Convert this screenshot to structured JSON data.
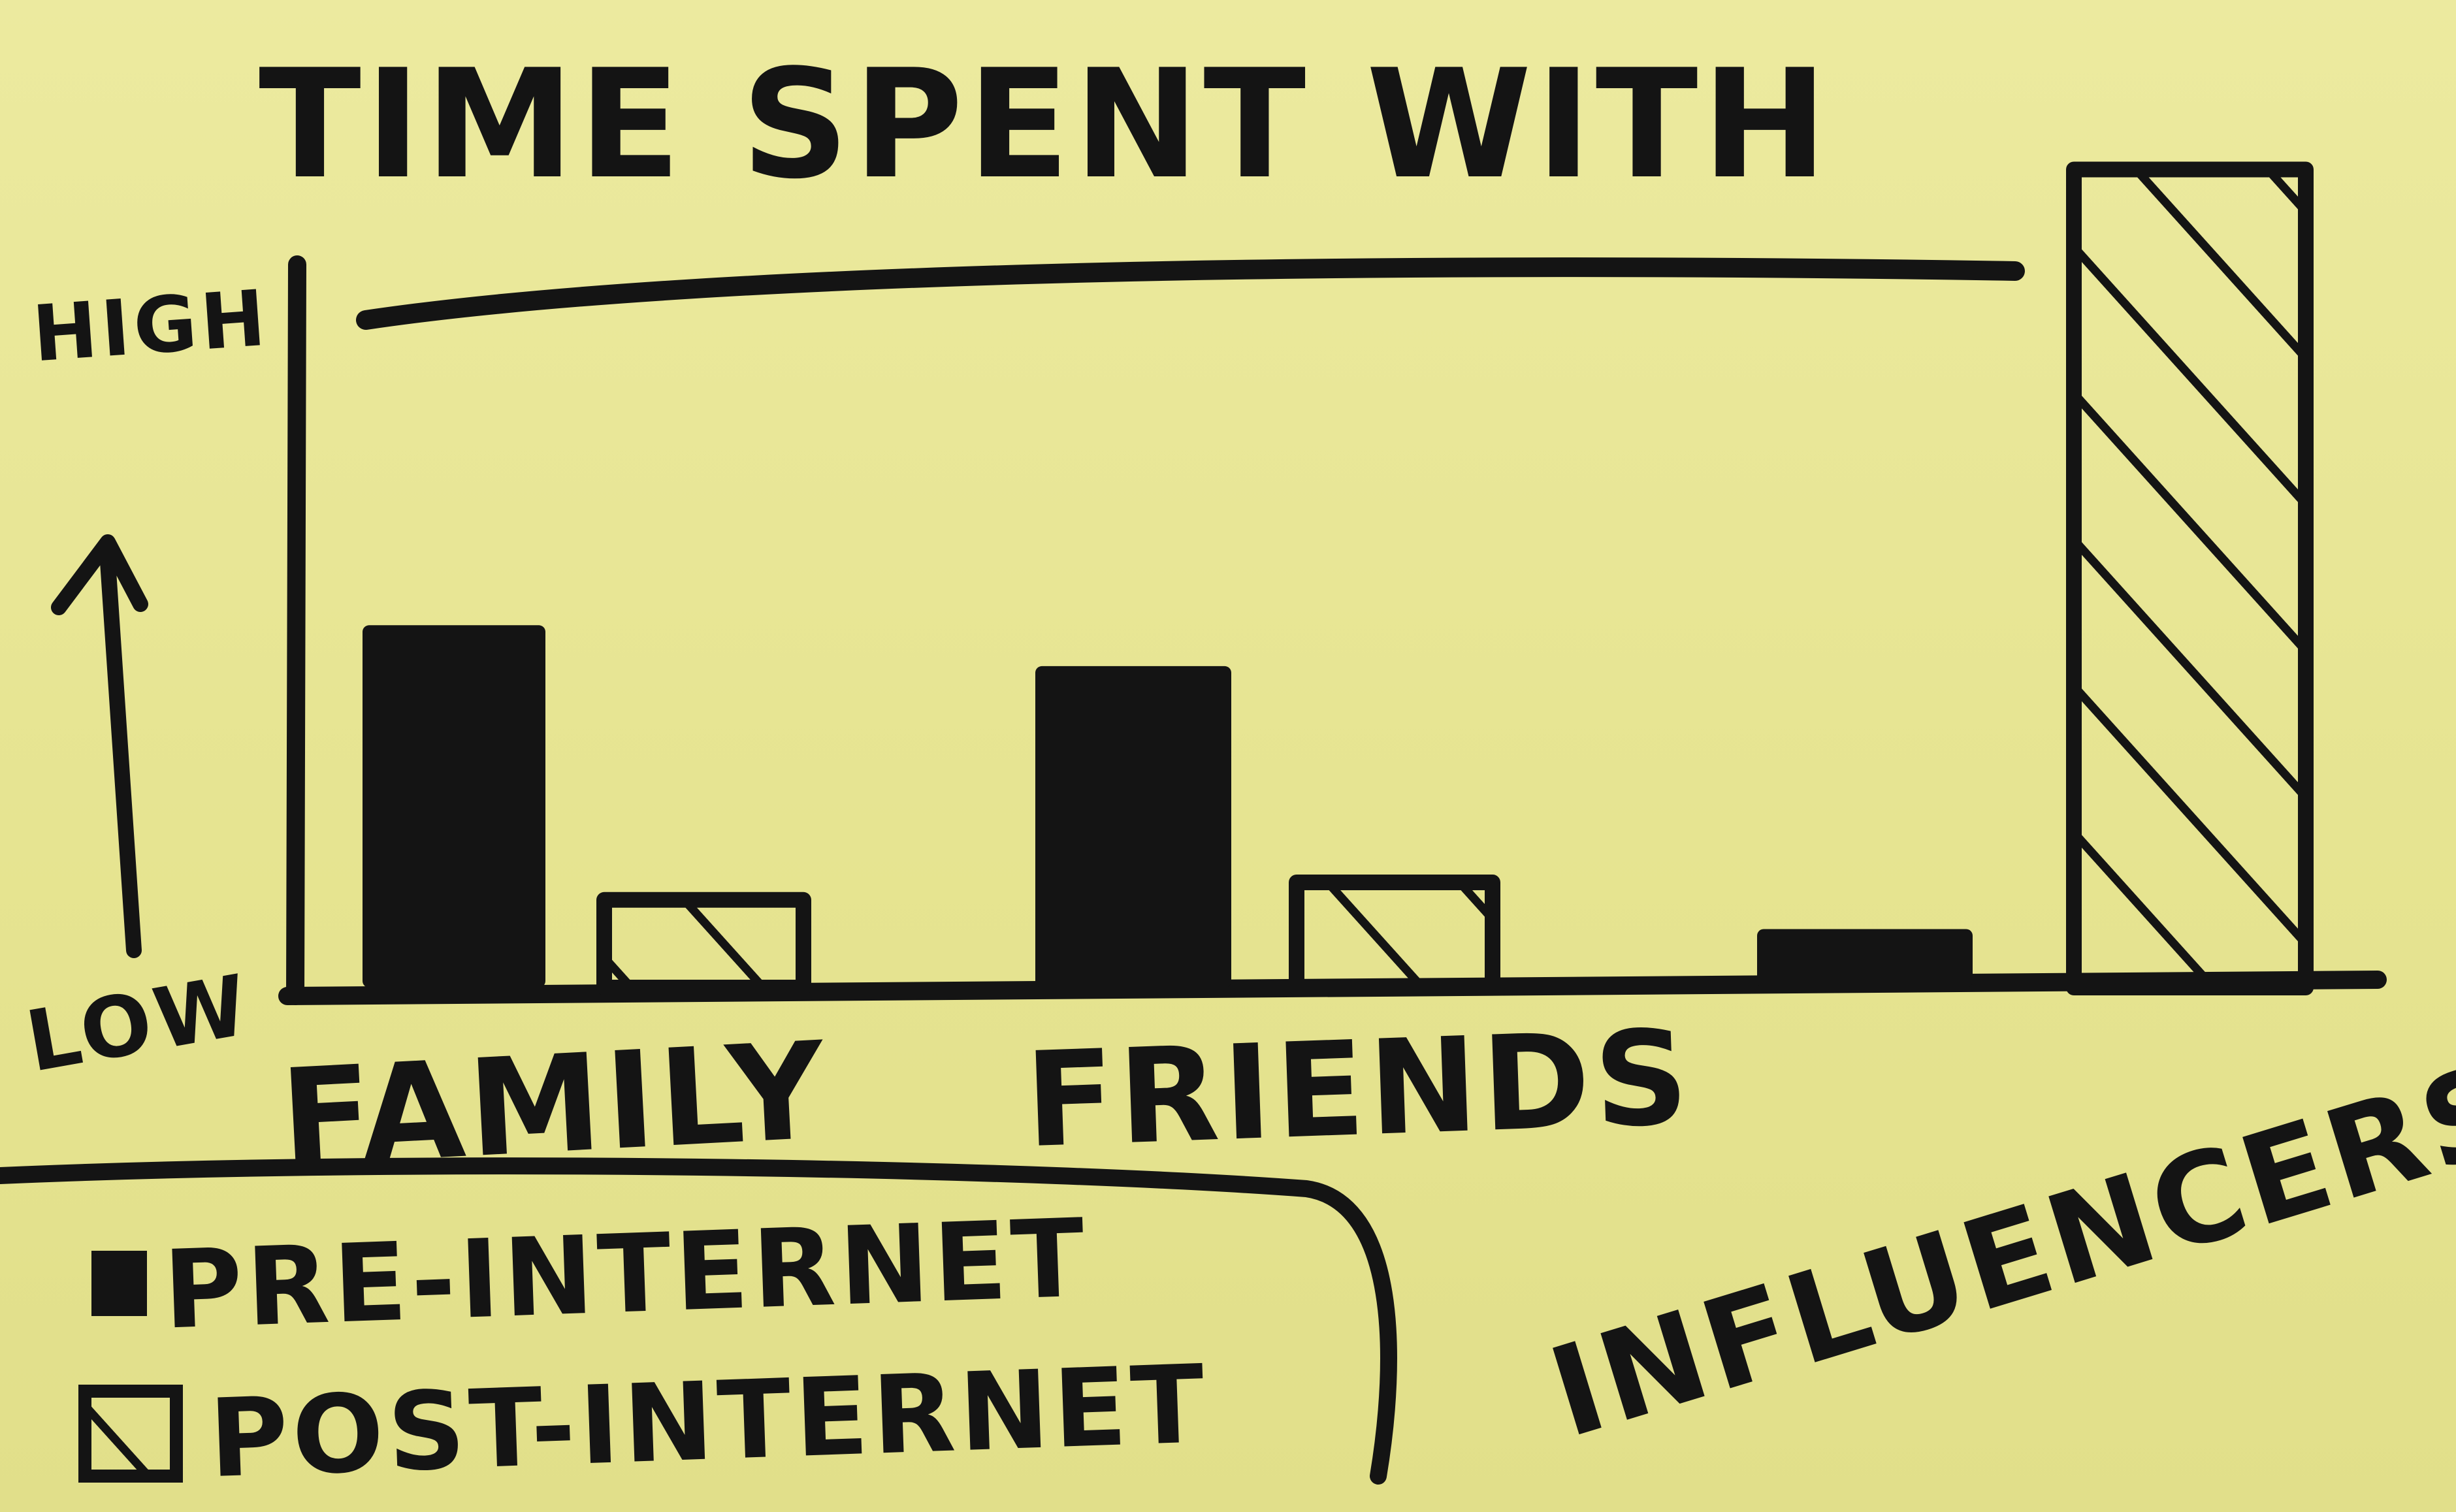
{
  "chart_data": {
    "type": "bar",
    "title": "TIME SPENT WITH",
    "categories": [
      "FAMILY",
      "FRIENDS",
      "INFLUENCERS"
    ],
    "series": [
      {
        "name": "PRE-INTERNET",
        "values": [
          0.62,
          0.55,
          0.1
        ],
        "style": "filled"
      },
      {
        "name": "POST-INTERNET",
        "values": [
          0.15,
          0.18,
          1.4
        ],
        "style": "hatched"
      }
    ],
    "ylabel_high": "HIGH",
    "ylabel_low": "LOW",
    "ylim": [
      0,
      1.5
    ],
    "legend_placement": "bottom-left",
    "colors": {
      "ink": "#141414",
      "paper": "#e9e79a"
    }
  }
}
